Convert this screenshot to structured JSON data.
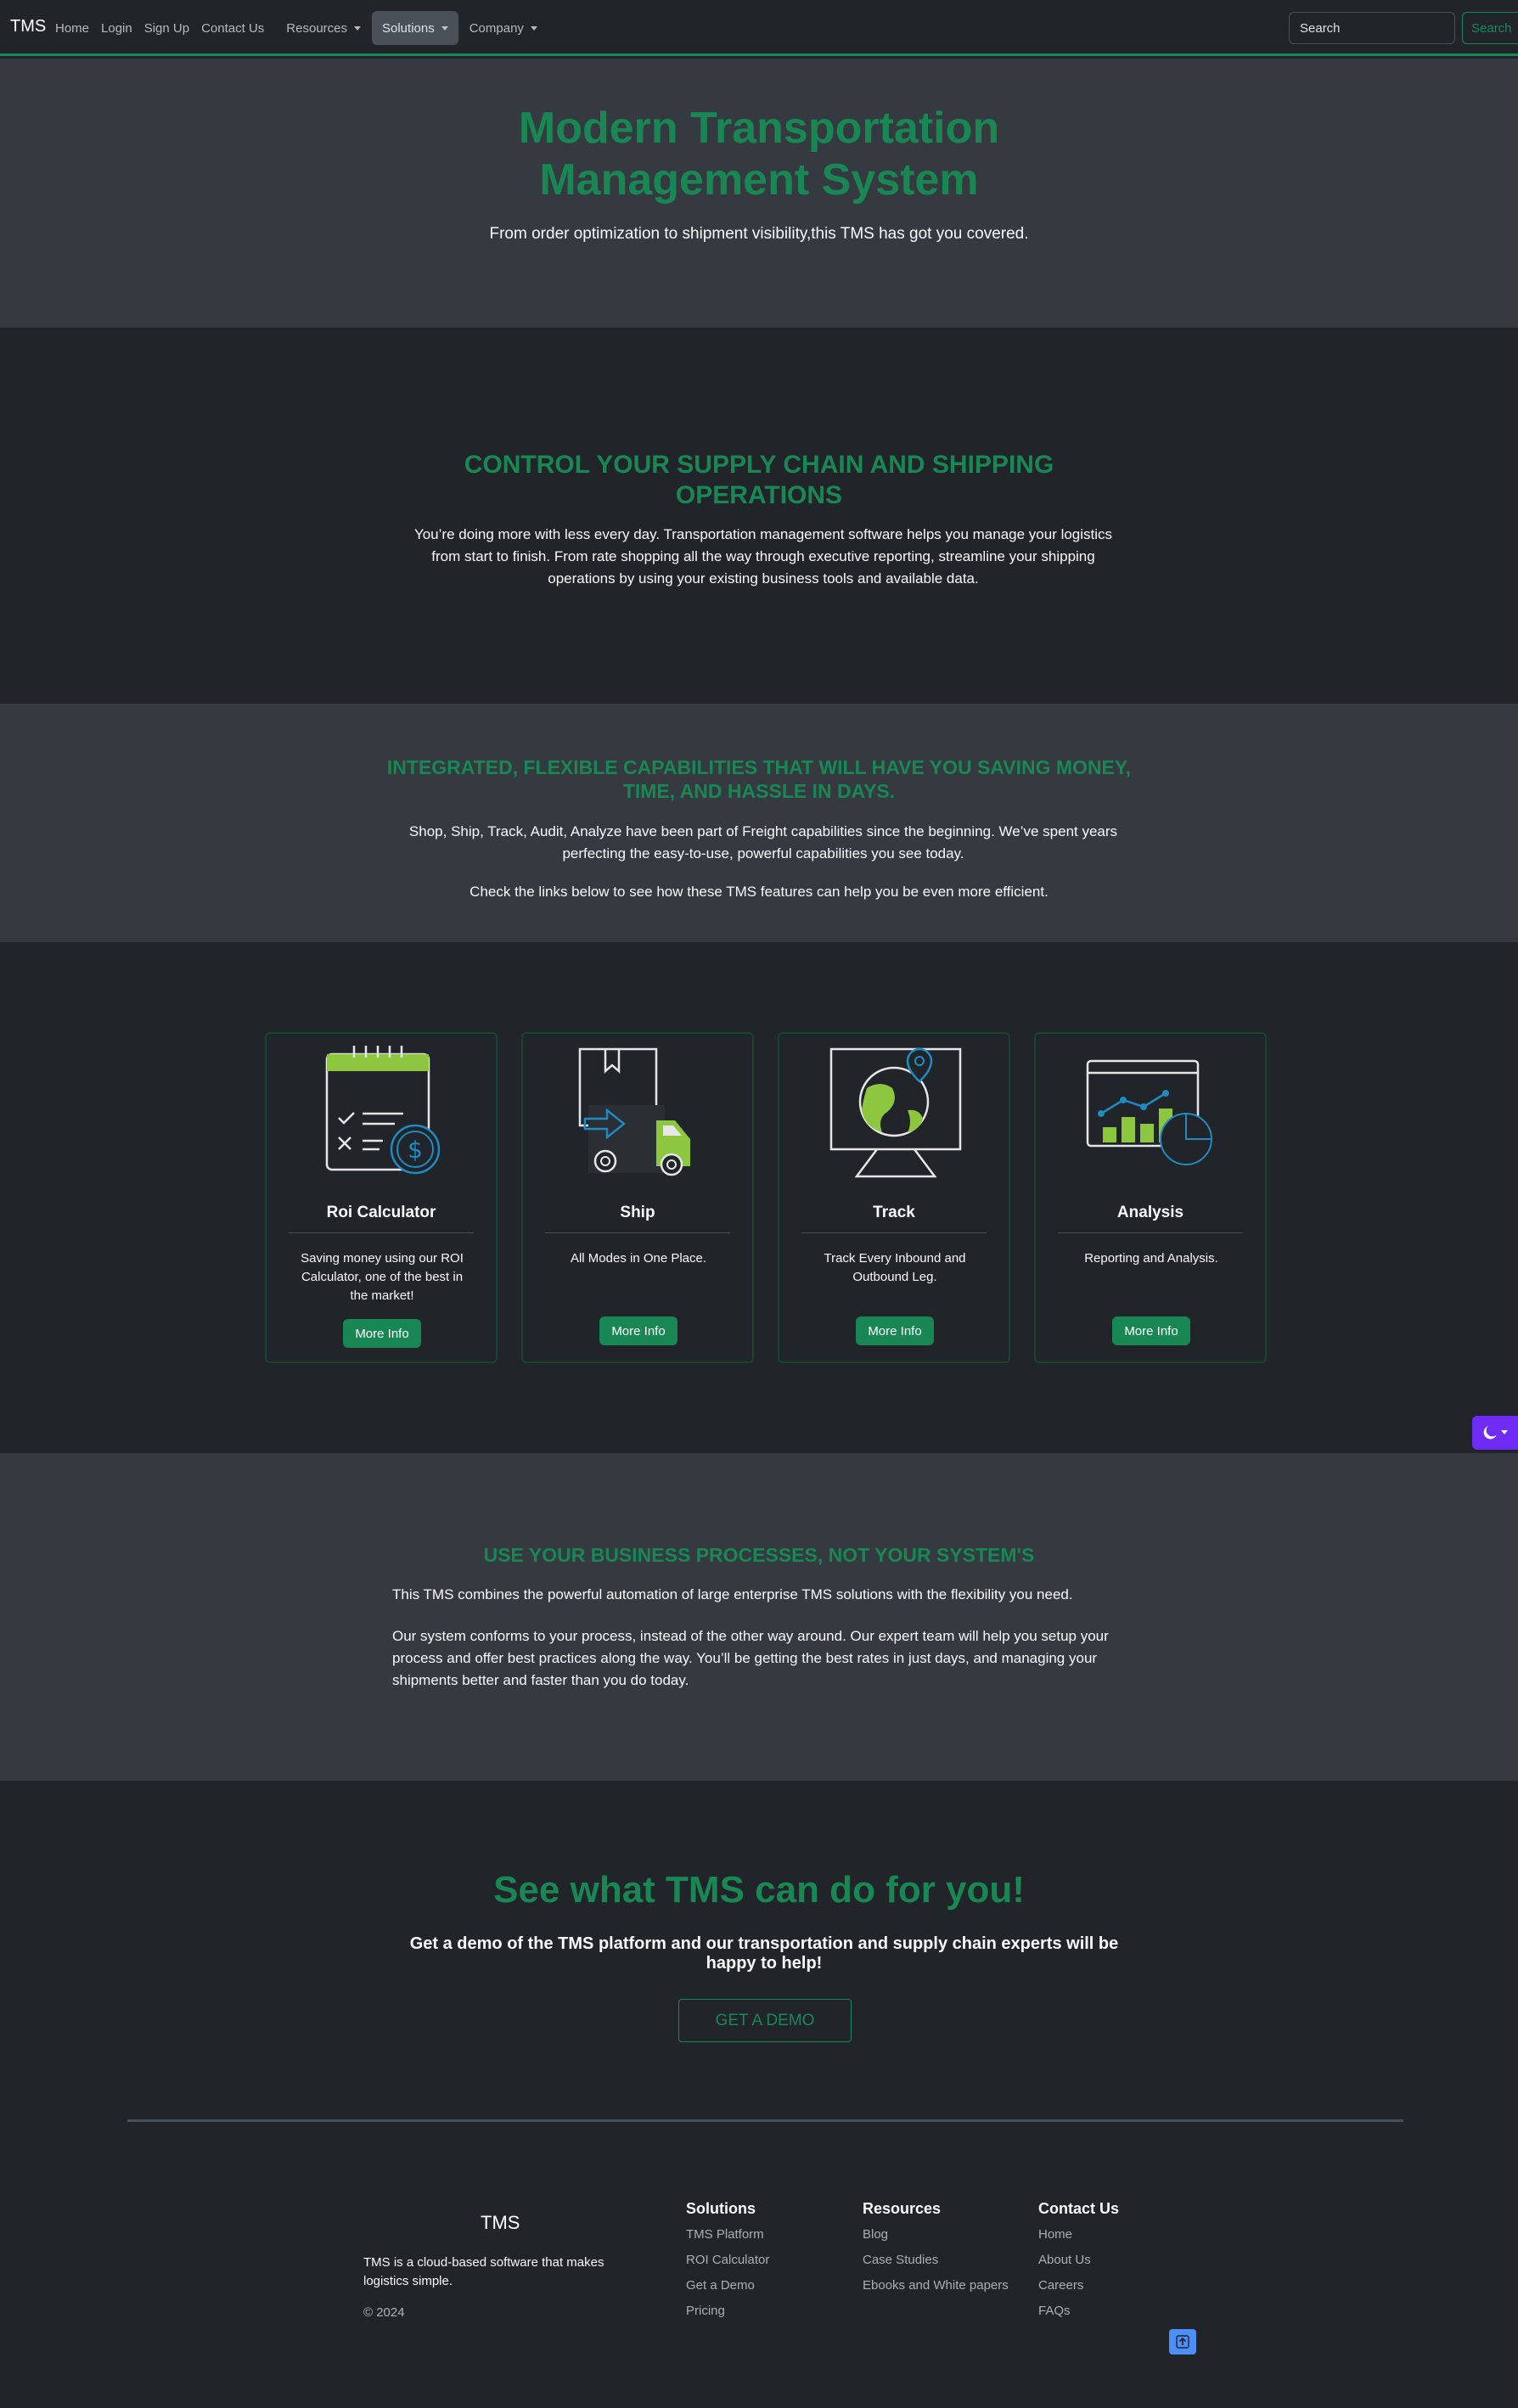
{
  "nav": {
    "brand": "TMS",
    "links": [
      "Home",
      "Login",
      "Sign Up",
      "Contact Us"
    ],
    "dropdowns": [
      "Resources",
      "Solutions",
      "Company"
    ],
    "search_placeholder": "Search",
    "search_button": "Search"
  },
  "hero": {
    "title_line1": "Modern Transportation",
    "title_line2": "Management System",
    "subtitle": "From order optimization to shipment visibility,this TMS has got you covered."
  },
  "control": {
    "title_line1": "CONTROL YOUR SUPPLY CHAIN AND SHIPPING",
    "title_line2": "OPERATIONS",
    "text": "You’re doing more with less every day. Transportation management software helps you manage your logistics from start to finish. From rate shopping all the way through executive reporting, streamline your shipping operations by using your existing business tools and available data."
  },
  "integrated": {
    "title_line1": "INTEGRATED, FLEXIBLE CAPABILITIES THAT WILL HAVE YOU SAVING MONEY,",
    "title_line2": "TIME, AND HASSLE IN DAYS.",
    "text1": "Shop, Ship, Track, Audit, Analyze have been part of Freight capabilities since the beginning. We’ve spent years perfecting the easy-to-use, powerful capabilities you see today.",
    "text2": "Check the links below to see how these TMS features can help you be even more efficient."
  },
  "cards": [
    {
      "title": "Roi Calculator",
      "text": "Saving money using our ROI Calculator, one of the best in the market!",
      "button": "More Info",
      "icon": "calculator-icon"
    },
    {
      "title": "Ship",
      "text": "All Modes in One Place.",
      "button": "More Info",
      "icon": "truck-icon"
    },
    {
      "title": "Track",
      "text": "Track Every Inbound and Outbound Leg.",
      "button": "More Info",
      "icon": "globe-monitor-icon"
    },
    {
      "title": "Analysis",
      "text": "Reporting and Analysis.",
      "button": "More Info",
      "icon": "chart-board-icon"
    }
  ],
  "business": {
    "title": "USE YOUR BUSINESS PROCESSES, NOT YOUR SYSTEM'S",
    "text1": "This TMS combines the powerful automation of large enterprise TMS solutions with the flexibility you need.",
    "text2": "Our system conforms to your process, instead of the other way around. Our expert team will help you setup your process and offer best practices along the way. You’ll be getting the best rates in just days, and managing your shipments better and faster than you do today."
  },
  "demo": {
    "title": "See what TMS can do for you!",
    "text": "Get a demo of the TMS platform and our transportation and supply chain experts will be happy to help!",
    "button": "GET A DEMO"
  },
  "footer": {
    "brand": "TMS",
    "description": "TMS is a cloud-based software that makes logistics simple.",
    "copyright": "© 2024",
    "columns": [
      {
        "title": "Solutions",
        "links": [
          "TMS Platform",
          "ROI Calculator",
          "Get a Demo",
          "Pricing"
        ]
      },
      {
        "title": "Resources",
        "links": [
          "Blog",
          "Case Studies",
          "Ebooks and White papers"
        ]
      },
      {
        "title": "Contact Us",
        "links": [
          "Home",
          "About Us",
          "Careers",
          "FAQs"
        ]
      }
    ]
  },
  "colors": {
    "accent": "#198754",
    "theme_toggle": "#6f2cf4",
    "back_to_top": "#4e8ef7"
  }
}
